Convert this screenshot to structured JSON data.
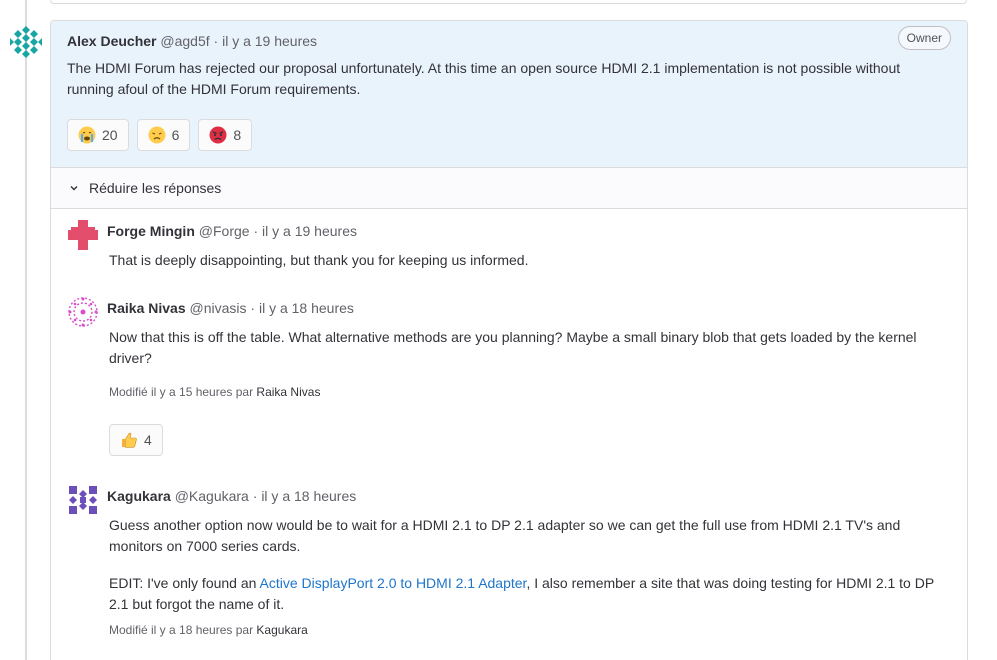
{
  "main_note": {
    "author": "Alex Deucher",
    "handle": "@agd5f",
    "time": "il y a 19 heures",
    "badge": "Owner",
    "body": "The HDMI Forum has rejected our proposal unfortunately. At this time an open source HDMI 2.1 implementation is not possible without running afoul of the HDMI Forum requirements.",
    "reactions": [
      {
        "icon": "crying-face-icon",
        "count": "20"
      },
      {
        "icon": "disappointed-face-icon",
        "count": "6"
      },
      {
        "icon": "angry-face-icon",
        "count": "8"
      }
    ]
  },
  "collapse_label": "Réduire les réponses",
  "separator": "·",
  "replies": [
    {
      "author": "Forge Mingin",
      "handle": "@Forge",
      "time": "il y a 19 heures",
      "body": "That is deeply disappointing, but thank you for keeping us informed."
    },
    {
      "author": "Raika Nivas",
      "handle": "@nivasis",
      "time": "il y a 18 heures",
      "body": "Now that this is off the table. What alternative methods are you planning? Maybe a small binary blob that gets loaded by the kernel driver?",
      "edited": "Modifié il y a 15 heures par",
      "editor": "Raika Nivas",
      "reactions": [
        {
          "icon": "thumbs-up-icon",
          "count": "4"
        }
      ]
    },
    {
      "author": "Kagukara",
      "handle": "@Kagukara",
      "time": "il y a 18 heures",
      "body": "Guess another option now would be to wait for a HDMI 2.1 to DP 2.1 adapter so we can get the full use from HDMI 2.1 TV's and monitors on 7000 series cards.",
      "body2_prefix": "EDIT: I've only found an ",
      "body2_link": "Active DisplayPort 2.0 to HDMI 2.1 Adapter",
      "body2_suffix": ", I also remember a site that was doing testing for HDMI 2.1 to DP 2.1 but forgot the name of it.",
      "edited": "Modifié il y a 18 heures par",
      "editor": "Kagukara"
    }
  ],
  "colors": {
    "note_bg": "#e9f3fc",
    "link": "#1f75cb",
    "border": "#dcdcde",
    "avatar_forge": "#e24e6b",
    "avatar_raika": "#d64ecb",
    "avatar_kagukara": "#6b4fbb",
    "avatar_alex": "#1aa5a5"
  }
}
